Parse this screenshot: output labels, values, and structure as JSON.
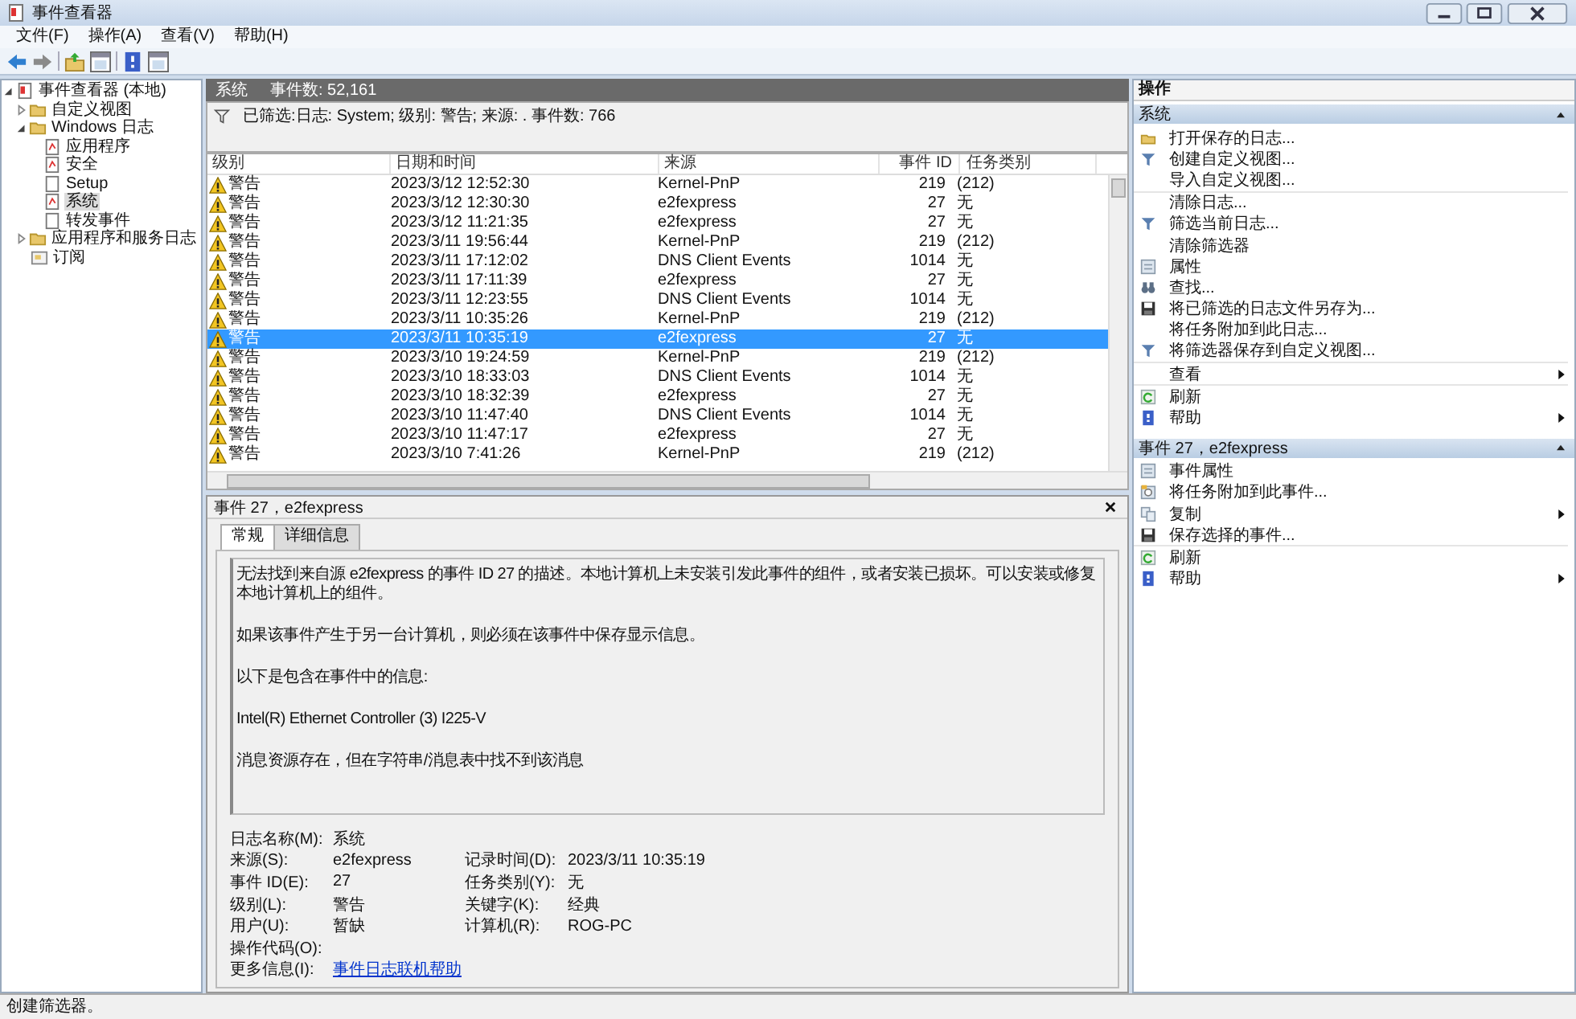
{
  "window": {
    "title": "事件查看器"
  },
  "menu": [
    "文件(F)",
    "操作(A)",
    "查看(V)",
    "帮助(H)"
  ],
  "tree": [
    {
      "label": "事件查看器 (本地)",
      "kind": "root",
      "selected": false,
      "expanded": true,
      "children": [
        {
          "label": "自定义视图",
          "kind": "folder",
          "selected": false,
          "expanded": false
        },
        {
          "label": "Windows 日志",
          "kind": "folder",
          "selected": false,
          "expanded": true,
          "children": [
            {
              "label": "应用程序",
              "kind": "log",
              "selected": false
            },
            {
              "label": "安全",
              "kind": "log",
              "selected": false
            },
            {
              "label": "Setup",
              "kind": "plain",
              "selected": false
            },
            {
              "label": "系统",
              "kind": "log",
              "selected": true
            },
            {
              "label": "转发事件",
              "kind": "plain",
              "selected": false
            }
          ]
        },
        {
          "label": "应用程序和服务日志",
          "kind": "folder",
          "selected": false,
          "expanded": false
        },
        {
          "label": "订阅",
          "kind": "sub",
          "selected": false
        }
      ]
    }
  ],
  "log_header": {
    "name": "系统",
    "count": "事件数: 52,161"
  },
  "filter": "已筛选:日志: System; 级别: 警告; 来源: . 事件数: 766",
  "table": {
    "columns": [
      "级别",
      "日期和时间",
      "来源",
      "事件 ID",
      "任务类别"
    ],
    "rows": [
      {
        "level": "警告",
        "datetime": "2023/3/12 12:52:30",
        "source": "Kernel-PnP",
        "event_id": "219",
        "task_category": "(212)",
        "selected": false
      },
      {
        "level": "警告",
        "datetime": "2023/3/12 12:30:30",
        "source": "e2fexpress",
        "event_id": "27",
        "task_category": "无",
        "selected": false
      },
      {
        "level": "警告",
        "datetime": "2023/3/12 11:21:35",
        "source": "e2fexpress",
        "event_id": "27",
        "task_category": "无",
        "selected": false
      },
      {
        "level": "警告",
        "datetime": "2023/3/11 19:56:44",
        "source": "Kernel-PnP",
        "event_id": "219",
        "task_category": "(212)",
        "selected": false
      },
      {
        "level": "警告",
        "datetime": "2023/3/11 17:12:02",
        "source": "DNS Client Events",
        "event_id": "1014",
        "task_category": "无",
        "selected": false
      },
      {
        "level": "警告",
        "datetime": "2023/3/11 17:11:39",
        "source": "e2fexpress",
        "event_id": "27",
        "task_category": "无",
        "selected": false
      },
      {
        "level": "警告",
        "datetime": "2023/3/11 12:23:55",
        "source": "DNS Client Events",
        "event_id": "1014",
        "task_category": "无",
        "selected": false
      },
      {
        "level": "警告",
        "datetime": "2023/3/11 10:35:26",
        "source": "Kernel-PnP",
        "event_id": "219",
        "task_category": "(212)",
        "selected": false
      },
      {
        "level": "警告",
        "datetime": "2023/3/11 10:35:19",
        "source": "e2fexpress",
        "event_id": "27",
        "task_category": "无",
        "selected": true
      },
      {
        "level": "警告",
        "datetime": "2023/3/10 19:24:59",
        "source": "Kernel-PnP",
        "event_id": "219",
        "task_category": "(212)",
        "selected": false
      },
      {
        "level": "警告",
        "datetime": "2023/3/10 18:33:03",
        "source": "DNS Client Events",
        "event_id": "1014",
        "task_category": "无",
        "selected": false
      },
      {
        "level": "警告",
        "datetime": "2023/3/10 18:32:39",
        "source": "e2fexpress",
        "event_id": "27",
        "task_category": "无",
        "selected": false
      },
      {
        "level": "警告",
        "datetime": "2023/3/10 11:47:40",
        "source": "DNS Client Events",
        "event_id": "1014",
        "task_category": "无",
        "selected": false
      },
      {
        "level": "警告",
        "datetime": "2023/3/10 11:47:17",
        "source": "e2fexpress",
        "event_id": "27",
        "task_category": "无",
        "selected": false
      },
      {
        "level": "警告",
        "datetime": "2023/3/10 7:41:26",
        "source": "Kernel-PnP",
        "event_id": "219",
        "task_category": "(212)",
        "selected": false
      }
    ]
  },
  "detail": {
    "title": "事件 27，e2fexpress",
    "tabs": [
      {
        "label": "常规",
        "selected": true
      },
      {
        "label": "详细信息",
        "selected": false
      }
    ],
    "description": [
      "无法找到来自源 e2fexpress 的事件 ID 27 的描述。本地计算机上未安装引发此事件的组件，或者安装已损坏。可以安装或修复本地计算机上的组件。",
      "如果该事件产生于另一台计算机，则必须在该事件中保存显示信息。",
      "以下是包含在事件中的信息:",
      "Intel(R) Ethernet Controller (3) I225-V",
      "消息资源存在，但在字符串/消息表中找不到该消息"
    ],
    "fields": [
      [
        {
          "label": "日志名称(M):",
          "value": "系统",
          "kind": "text"
        }
      ],
      [
        {
          "label": "来源(S):",
          "value": "e2fexpress",
          "kind": "text"
        },
        {
          "label": "记录时间(D):",
          "value": "2023/3/11 10:35:19",
          "kind": "text"
        }
      ],
      [
        {
          "label": "事件 ID(E):",
          "value": "27",
          "kind": "text"
        },
        {
          "label": "任务类别(Y):",
          "value": "无",
          "kind": "text"
        }
      ],
      [
        {
          "label": "级别(L):",
          "value": "警告",
          "kind": "text"
        },
        {
          "label": "关键字(K):",
          "value": "经典",
          "kind": "text"
        }
      ],
      [
        {
          "label": "用户(U):",
          "value": "暂缺",
          "kind": "text"
        },
        {
          "label": "计算机(R):",
          "value": "ROG-PC",
          "kind": "text"
        }
      ],
      [
        {
          "label": "操作代码(O):",
          "kind": "empty"
        }
      ],
      [
        {
          "label": "更多信息(I):",
          "value": "事件日志联机帮助",
          "kind": "link"
        }
      ]
    ]
  },
  "actions": {
    "title": "操作",
    "sections": [
      {
        "title": "系统",
        "expanded": true,
        "items": [
          {
            "label": "打开保存的日志...",
            "kind": "folder",
            "submenu": false,
            "divider": false
          },
          {
            "label": "创建自定义视图...",
            "kind": "funnel",
            "submenu": false,
            "divider": false
          },
          {
            "label": "导入自定义视图...",
            "kind": "none",
            "submenu": false,
            "divider": false
          },
          {
            "label": "清除日志...",
            "kind": "none",
            "submenu": false,
            "divider": true
          },
          {
            "label": "筛选当前日志...",
            "kind": "funnel",
            "submenu": false,
            "divider": false
          },
          {
            "label": "清除筛选器",
            "kind": "none",
            "submenu": false,
            "divider": false
          },
          {
            "label": "属性",
            "kind": "props",
            "submenu": false,
            "divider": false
          },
          {
            "label": "查找...",
            "kind": "find",
            "submenu": false,
            "divider": false
          },
          {
            "label": "将已筛选的日志文件另存为...",
            "kind": "save",
            "submenu": false,
            "divider": false
          },
          {
            "label": "将任务附加到此日志...",
            "kind": "none",
            "submenu": false,
            "divider": false
          },
          {
            "label": "将筛选器保存到自定义视图...",
            "kind": "funnel",
            "submenu": false,
            "divider": false
          },
          {
            "label": "查看",
            "kind": "none",
            "submenu": true,
            "divider": true
          },
          {
            "label": "刷新",
            "kind": "refresh",
            "submenu": false,
            "divider": true
          },
          {
            "label": "帮助",
            "kind": "help",
            "submenu": true,
            "divider": false
          }
        ]
      },
      {
        "title": "事件 27，e2fexpress",
        "expanded": true,
        "items": [
          {
            "label": "事件属性",
            "kind": "props",
            "submenu": false,
            "divider": false
          },
          {
            "label": "将任务附加到此事件...",
            "kind": "task",
            "submenu": false,
            "divider": false
          },
          {
            "label": "复制",
            "kind": "copy",
            "submenu": true,
            "divider": false
          },
          {
            "label": "保存选择的事件...",
            "kind": "save",
            "submenu": false,
            "divider": false
          },
          {
            "label": "刷新",
            "kind": "refresh",
            "submenu": false,
            "divider": true
          },
          {
            "label": "帮助",
            "kind": "help",
            "submenu": true,
            "divider": false
          }
        ]
      }
    ]
  },
  "status_bar": "创建筛选器。"
}
